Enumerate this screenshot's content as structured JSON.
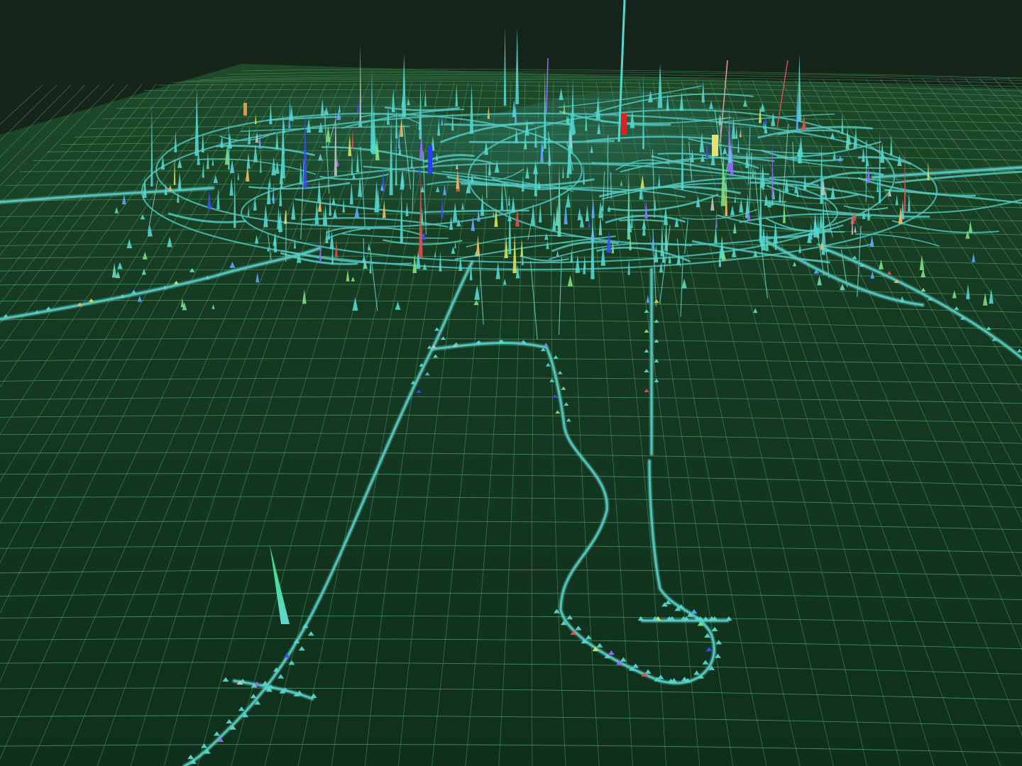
{
  "colors": {
    "background": "#15241a",
    "terrain_grid": "#4fa46a",
    "terrain_grid_far": "#5fbf75",
    "terrain_fill_near": "#123a22",
    "terrain_fill_far": "#173f24",
    "road": "#52c8c0",
    "road_glow": "#7fe6dd",
    "spike_palette": [
      "#55d6cf",
      "#6ad9b8",
      "#7fe07f",
      "#5fa8ff",
      "#3a4cff",
      "#9a6bff",
      "#d9e35a",
      "#e05050",
      "#f0c060",
      "#c7c7c7"
    ]
  },
  "icons": {
    "spike": "spike-icon",
    "road": "road-icon"
  }
}
